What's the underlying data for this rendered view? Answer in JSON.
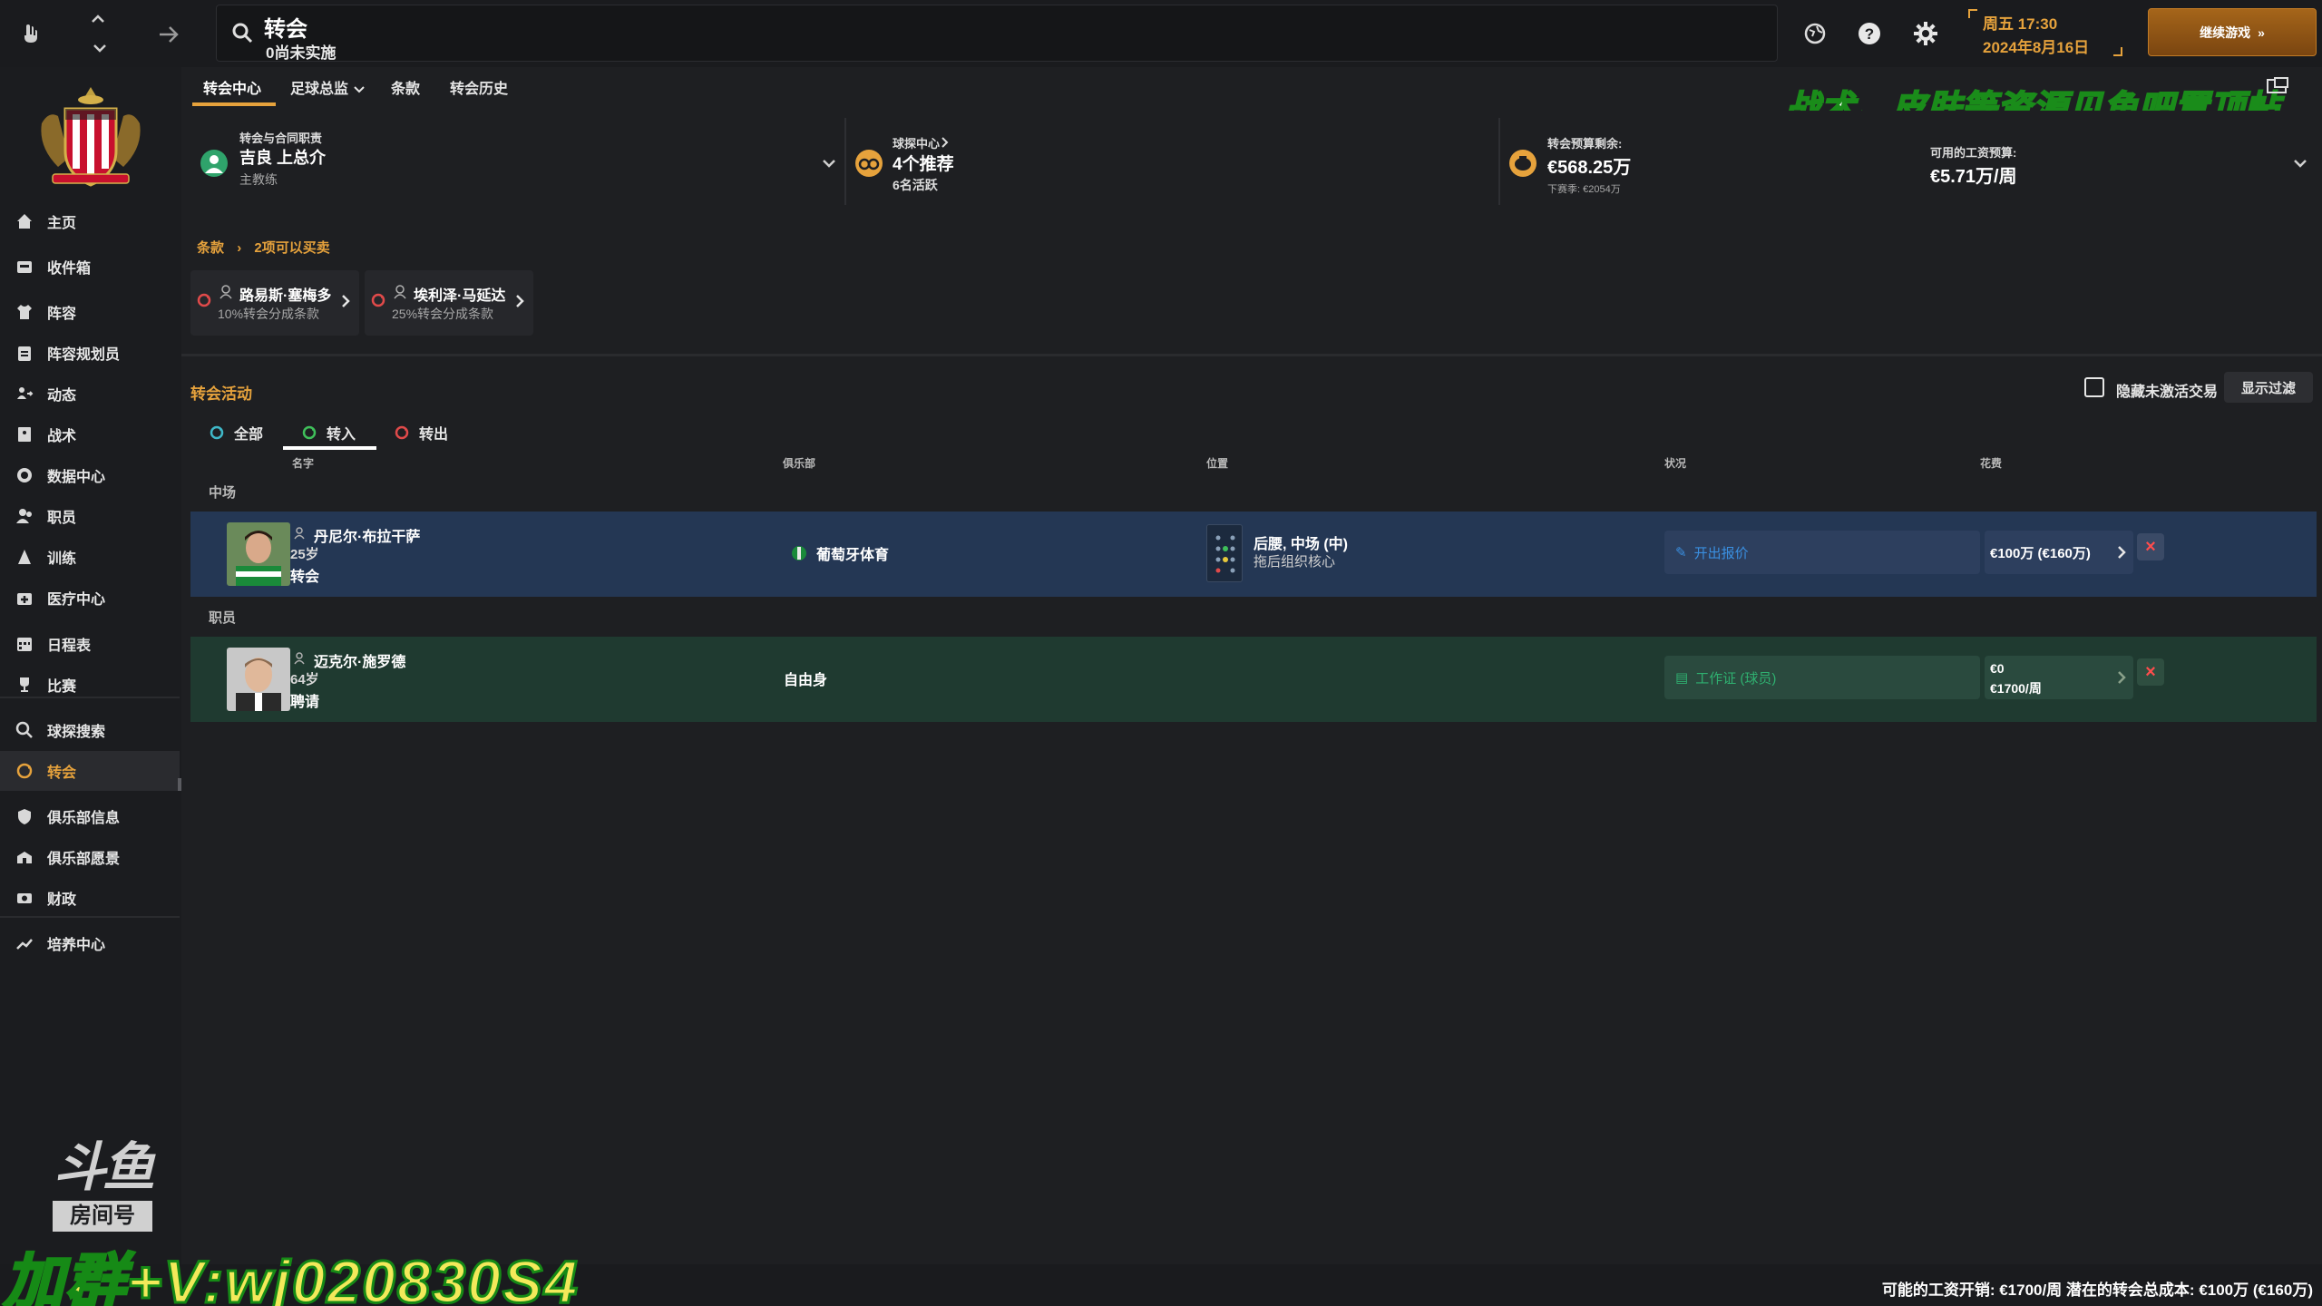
{
  "topbar": {
    "search_title": "转会",
    "search_subtitle": "0尚未实施",
    "datetime_day": "周五 17:30",
    "datetime_date": "2024年8月16日",
    "continue_label": "继续游戏"
  },
  "sidebar": {
    "items": [
      {
        "label": "主页",
        "icon": "home-icon"
      },
      {
        "label": "收件箱",
        "icon": "inbox-icon"
      },
      {
        "label": "阵容",
        "icon": "shirt-icon"
      },
      {
        "label": "阵容规划员",
        "icon": "clipboard-icon"
      },
      {
        "label": "动态",
        "icon": "dynamics-icon"
      },
      {
        "label": "战术",
        "icon": "tactics-icon"
      },
      {
        "label": "数据中心",
        "icon": "data-icon"
      },
      {
        "label": "职员",
        "icon": "staff-icon"
      },
      {
        "label": "训练",
        "icon": "training-icon"
      },
      {
        "label": "医疗中心",
        "icon": "medical-icon"
      },
      {
        "label": "日程表",
        "icon": "calendar-icon"
      },
      {
        "label": "比赛",
        "icon": "trophy-icon"
      },
      {
        "label": "球探搜索",
        "icon": "search-icon"
      },
      {
        "label": "转会",
        "icon": "transfer-icon"
      },
      {
        "label": "俱乐部信息",
        "icon": "shield-icon"
      },
      {
        "label": "俱乐部愿景",
        "icon": "vision-icon"
      },
      {
        "label": "财政",
        "icon": "finance-icon"
      },
      {
        "label": "培养中心",
        "icon": "development-icon"
      }
    ]
  },
  "subtabs": [
    "转会中心",
    "足球总监",
    "条款",
    "转会历史"
  ],
  "summary": {
    "responsible_label": "转会与合同职责",
    "responsible_name": "吉良 上总介",
    "responsible_role": "主教练",
    "scouting_label": "球探中心",
    "scouting_value": "4个推荐",
    "scouting_sub": "6名活跃",
    "budget_label": "转会预算剩余:",
    "budget_value": "€568.25万",
    "budget_next": "下赛季: €2054万",
    "wage_label": "可用的工资预算:",
    "wage_value": "€5.71万/周"
  },
  "watermark_top": "战术、皮肤等资源见鱼吧置顶帖",
  "breadcrumb": {
    "part1": "条款",
    "part2": "2项可以买卖"
  },
  "clauses": [
    {
      "name": "路易斯·塞梅多",
      "desc": "10%转会分成条款"
    },
    {
      "name": "埃利泽·马延达",
      "desc": "25%转会分成条款"
    }
  ],
  "activity": {
    "title": "转会活动",
    "hide_label": "隐藏未激活交易",
    "filter_label": "显示过滤",
    "tabs": [
      "全部",
      "转入",
      "转出"
    ],
    "columns": {
      "name": "名字",
      "club": "俱乐部",
      "position": "位置",
      "status": "状况",
      "fee": "花费"
    },
    "groups": [
      "中场",
      "职员"
    ],
    "rows": [
      {
        "name": "丹尼尔·布拉干萨",
        "age": "25岁",
        "type": "转会",
        "club": "葡萄牙体育",
        "position": "后腰, 中场 (中)",
        "role": "拖后组织核心",
        "status": "开出报价",
        "fee_line1": "€100万 (€160万)",
        "fee_line2": ""
      },
      {
        "name": "迈克尔·施罗德",
        "age": "64岁",
        "type": "聘请",
        "club": "自由身",
        "position": "",
        "role": "",
        "status": "工作证 (球员)",
        "fee_line1": "€0",
        "fee_line2": "€1700/周"
      }
    ]
  },
  "footer": {
    "text": "可能的工资开销: €1700/周 潜在的转会总成本: €100万 (€160万)"
  },
  "watermark_bottom": "加群+V:wj020830S4",
  "douyu": {
    "brand": "斗鱼",
    "room": "房间号"
  },
  "colors": {
    "accent": "#e6a23c",
    "row_selected": "#243754",
    "row_staff": "#1f3a30",
    "delete": "#ff4d4d"
  }
}
